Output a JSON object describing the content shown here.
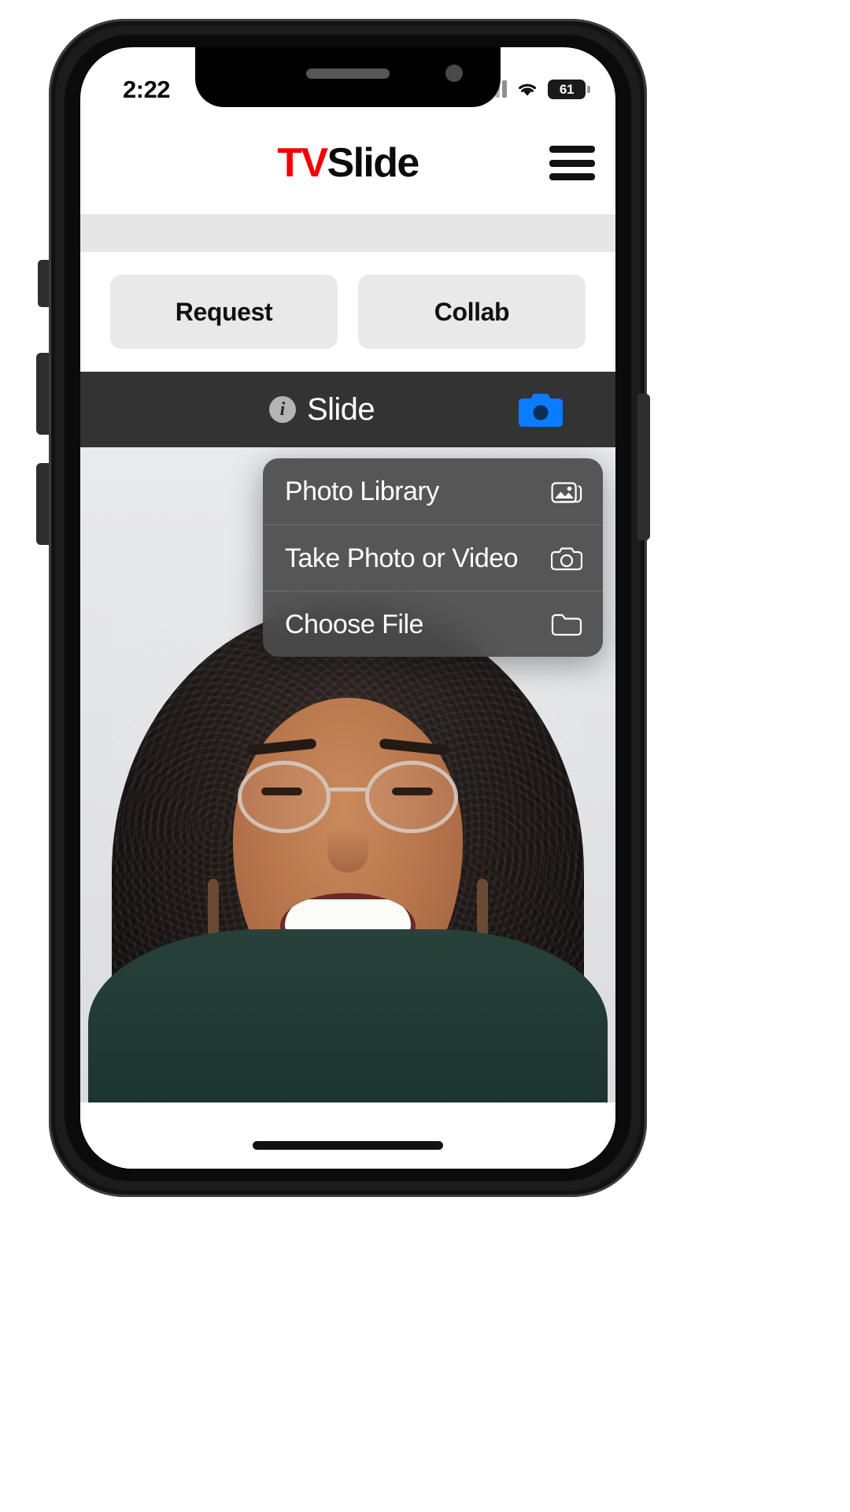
{
  "status_bar": {
    "time": "2:22",
    "signal_icon": "cellular-signal-icon",
    "wifi_icon": "wifi-icon",
    "battery_level": "61",
    "battery_icon": "battery-icon"
  },
  "header": {
    "brand_first": "TV",
    "brand_second": "Slide",
    "brand_first_color": "#f50000",
    "brand_second_color": "#0a0a0a",
    "menu_icon": "hamburger-menu-icon"
  },
  "actions": {
    "request_label": "Request",
    "collab_label": "Collab"
  },
  "slide_bar": {
    "info_icon_glyph": "i",
    "label": "Slide",
    "camera_icon": "camera-icon",
    "camera_color": "#0a7cff",
    "background_color": "#333333"
  },
  "action_sheet": {
    "items": [
      {
        "label": "Photo Library",
        "icon": "photo-library-icon"
      },
      {
        "label": "Take Photo or Video",
        "icon": "camera-outline-icon"
      },
      {
        "label": "Choose File",
        "icon": "folder-icon"
      }
    ]
  },
  "photo": {
    "alt": "portrait-photo-smiling-woman-with-glasses"
  }
}
